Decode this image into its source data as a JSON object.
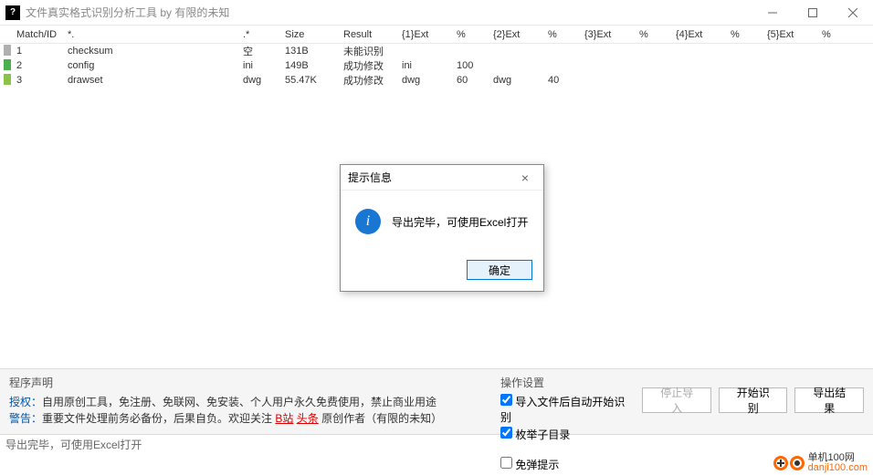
{
  "window": {
    "title": "文件真实格式识别分析工具 by 有限的未知",
    "icon_text": "?"
  },
  "columns": {
    "match": "Match/ID",
    "name": "*.",
    "ext": ".*",
    "size": "Size",
    "result": "Result",
    "e1": "{1}Ext",
    "p1": "%",
    "e2": "{2}Ext",
    "p2": "%",
    "e3": "{3}Ext",
    "p3": "%",
    "e4": "{4}Ext",
    "p4": "%",
    "e5": "{5}Ext",
    "p5": "%"
  },
  "rows": [
    {
      "id": "1",
      "match": "gray",
      "name": "checksum",
      "ext": "空",
      "size": "131B",
      "result": "未能识别",
      "e1": "",
      "p1": "",
      "e2": "",
      "p2": ""
    },
    {
      "id": "2",
      "match": "green",
      "name": "config",
      "ext": "ini",
      "size": "149B",
      "result": "成功修改",
      "e1": "ini",
      "p1": "100",
      "e2": "",
      "p2": ""
    },
    {
      "id": "3",
      "match": "lime",
      "name": "drawset",
      "ext": "dwg",
      "size": "55.47K",
      "result": "成功修改",
      "e1": "dwg",
      "p1": "60",
      "e2": "dwg",
      "p2": "40"
    }
  ],
  "notice": {
    "title": "程序声明",
    "line1a": "授权：",
    "line1b": "自用原创工具，免注册、免联网、免安装、个人用户永久免费使用，禁止商业用途",
    "line2a": "警告：",
    "line2b": "重要文件处理前务必备份，后果自负。",
    "line2c": "欢迎关注 ",
    "link1": "B站",
    "link2": "头条",
    "line2d": " 原创作者（有限的未知）"
  },
  "ops": {
    "title": "操作设置",
    "chk_auto": "导入文件后自动开始识别",
    "chk_sub": "枚举子目录",
    "chk_noalert": "免弹提示",
    "btn_stop": "停止导入",
    "btn_start": "开始识别",
    "btn_export": "导出结果"
  },
  "dialog": {
    "title": "提示信息",
    "message": "导出完毕，可使用Excel打开",
    "ok": "确定"
  },
  "status": "导出完毕，可使用Excel打开",
  "watermark": {
    "cn": "单机100网",
    "url": "danji100.com"
  }
}
